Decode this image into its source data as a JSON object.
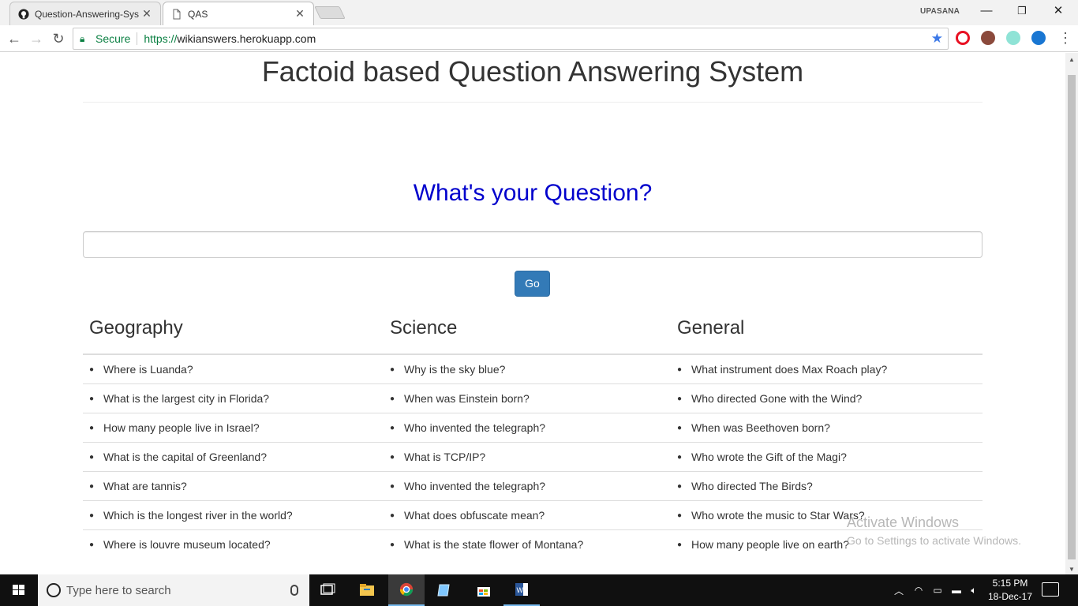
{
  "browser": {
    "tabs": [
      {
        "label": "Question-Answering-Sys",
        "icon": "github-icon"
      },
      {
        "label": "QAS",
        "icon": "page-icon"
      }
    ],
    "user_label": "UPASANA",
    "window_controls": {
      "minimize": "—",
      "maximize": "❐",
      "close": "✕"
    },
    "secure_label": "Secure",
    "url_scheme": "https://",
    "url_host": "wikianswers.herokuapp.com",
    "accent_color": "#0b8043"
  },
  "page": {
    "title": "Factoid based Question Answering System",
    "question_heading": "What's your Question?",
    "input_placeholder": "",
    "go_label": "Go",
    "categories": [
      {
        "name": "Geography",
        "questions": [
          "Where is Luanda?",
          "What is the largest city in Florida?",
          "How many people live in Israel?",
          "What is the capital of Greenland?",
          "What are tannis?",
          "Which is the longest river in the world?",
          "Where is louvre museum located?"
        ]
      },
      {
        "name": "Science",
        "questions": [
          "Why is the sky blue?",
          "When was Einstein born?",
          "Who invented the telegraph?",
          "What is TCP/IP?",
          "Who invented the telegraph?",
          "What does obfuscate mean?",
          "What is the state flower of Montana?"
        ]
      },
      {
        "name": "General",
        "questions": [
          "What instrument does Max Roach play?",
          "Who directed Gone with the Wind?",
          "When was Beethoven born?",
          "Who wrote the Gift of the Magi?",
          "Who directed The Birds?",
          "Who wrote the music to Star Wars?",
          "How many people live on earth?"
        ]
      }
    ],
    "button_color": "#337ab7",
    "heading_color": "#0000cc"
  },
  "watermark": {
    "line1": "Activate Windows",
    "line2": "Go to Settings to activate Windows."
  },
  "taskbar": {
    "search_placeholder": "Type here to search",
    "time": "5:15 PM",
    "date": "18-Dec-17"
  }
}
